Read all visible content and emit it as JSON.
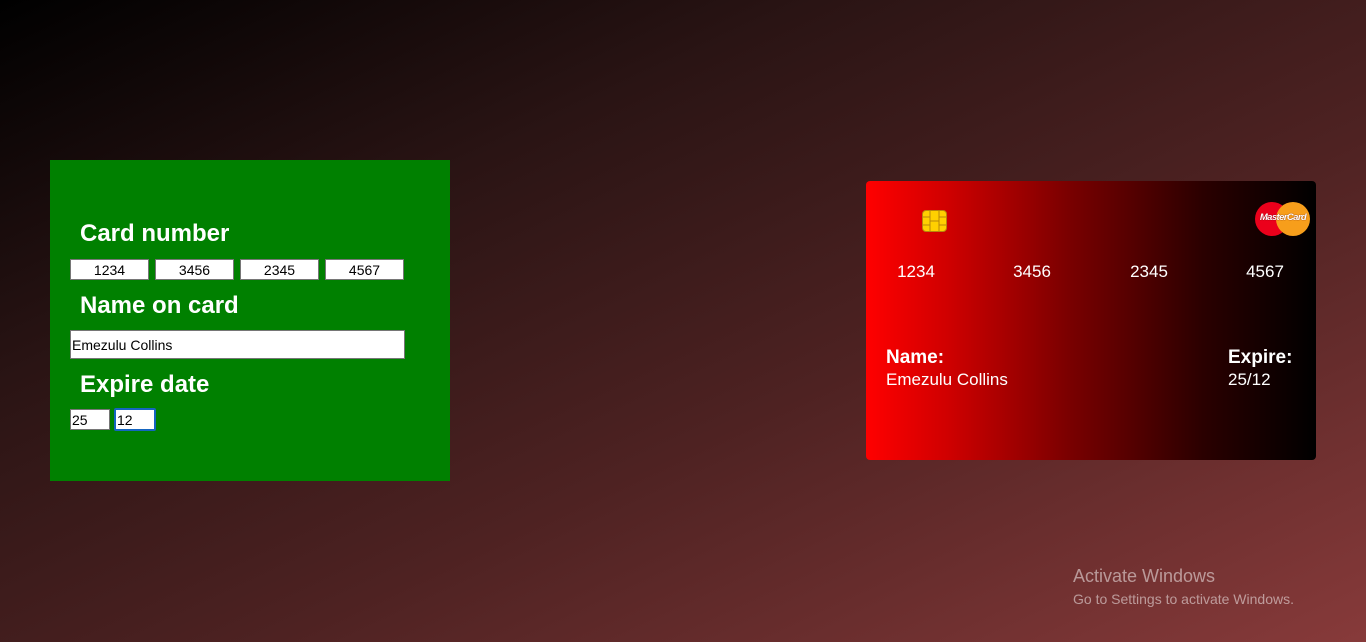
{
  "form": {
    "card_number_heading": "Card number",
    "card_number_values": [
      "1234",
      "3456",
      "2345",
      "4567"
    ],
    "name_heading": "Name on card",
    "name_value": "Emezulu Collins",
    "expire_heading": "Expire date",
    "expire_year": "25",
    "expire_month": "12",
    "background_color": "#008000"
  },
  "card": {
    "chip_icon": "chip-icon",
    "brand_logo_text": "MasterCard",
    "numbers": [
      "1234",
      "3456",
      "2345",
      "4567"
    ],
    "name_label": "Name:",
    "name_value": "Emezulu Collins",
    "expire_label": "Expire:",
    "expire_value": "25/12",
    "gradient_colors": [
      "#ff0000",
      "#000000"
    ]
  },
  "watermark": {
    "title": "Activate Windows",
    "subtitle": "Go to Settings to activate Windows."
  }
}
